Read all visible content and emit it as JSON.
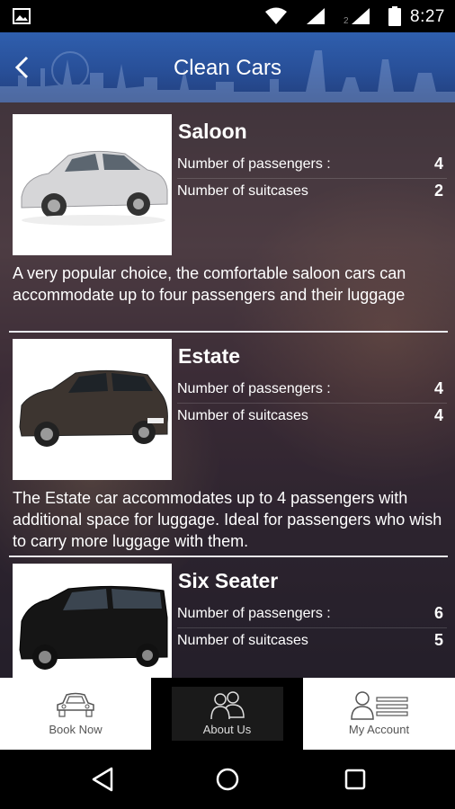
{
  "status_bar": {
    "time": "8:27",
    "sim2_label": "2"
  },
  "header": {
    "title": "Clean Cars",
    "back_icon": "chevron-left-icon"
  },
  "cars": [
    {
      "name": "Saloon",
      "passengers_label": "Number of passengers :",
      "passengers": "4",
      "suitcases_label": "Number of suitcases",
      "suitcases": "2",
      "description": "A very popular choice, the comfortable saloon cars can accommodate up to four passengers and their luggage",
      "color": "#dcdcdc"
    },
    {
      "name": "Estate",
      "passengers_label": "Number of passengers :",
      "passengers": "4",
      "suitcases_label": "Number of suitcases",
      "suitcases": "4",
      "description": "The Estate car accommodates up to 4 passengers with additional space for luggage. Ideal for passengers who wish to carry more luggage with them.",
      "color": "#3d3530"
    },
    {
      "name": "Six Seater",
      "passengers_label": "Number of passengers :",
      "passengers": "6",
      "suitcases_label": "Number of suitcases",
      "suitcases": "5",
      "description": "",
      "color": "#111111"
    }
  ],
  "bottom_nav": {
    "tabs": [
      {
        "label": "Book Now",
        "icon": "car-icon",
        "active": false
      },
      {
        "label": "About Us",
        "icon": "group-icon",
        "active": true
      },
      {
        "label": "My Account",
        "icon": "account-icon",
        "active": false
      }
    ]
  },
  "android_nav": {
    "back": "back-triangle-icon",
    "home": "home-circle-icon",
    "recents": "recents-square-icon"
  },
  "colors": {
    "header_blue": "#2b56a3",
    "nav_active": "#000000"
  }
}
